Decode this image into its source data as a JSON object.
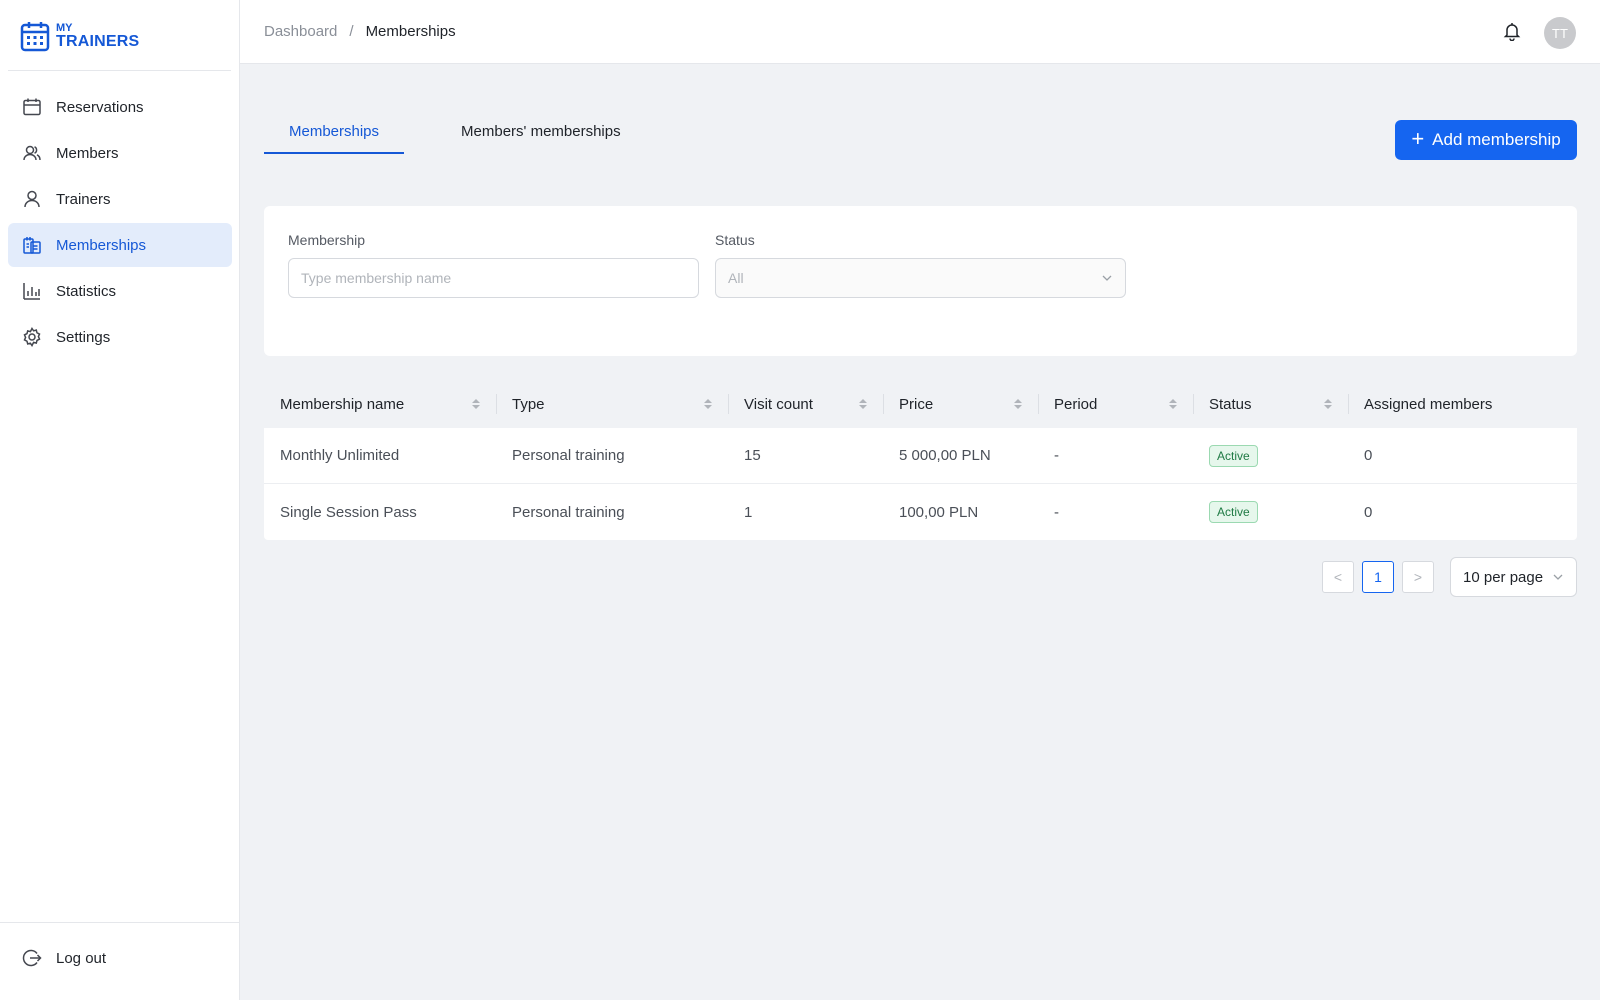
{
  "app": {
    "logo_line1": "MY",
    "logo_line2": "TRAINERS",
    "brand_color": "#1558d6"
  },
  "sidebar": {
    "items": [
      {
        "label": "Reservations",
        "icon": "calendar-icon",
        "active": false
      },
      {
        "label": "Members",
        "icon": "users-icon",
        "active": false
      },
      {
        "label": "Trainers",
        "icon": "user-icon",
        "active": false
      },
      {
        "label": "Memberships",
        "icon": "membership-card-icon",
        "active": true
      },
      {
        "label": "Statistics",
        "icon": "bar-chart-icon",
        "active": false
      },
      {
        "label": "Settings",
        "icon": "gear-icon",
        "active": false
      }
    ],
    "logout_label": "Log out"
  },
  "header": {
    "breadcrumb": [
      "Dashboard",
      "Memberships"
    ],
    "breadcrumb_separator": "/",
    "avatar_initials": "TT"
  },
  "tabs": [
    {
      "label": "Memberships",
      "active": true
    },
    {
      "label": "Members' memberships",
      "active": false
    }
  ],
  "add_button_label": "Add membership",
  "filters": {
    "membership_label": "Membership",
    "membership_placeholder": "Type membership name",
    "membership_value": "",
    "status_label": "Status",
    "status_value": "All"
  },
  "table": {
    "columns": [
      "Membership name",
      "Type",
      "Visit count",
      "Price",
      "Period",
      "Status",
      "Assigned members"
    ],
    "rows": [
      {
        "name": "Monthly Unlimited",
        "type": "Personal training",
        "visit_count": "15",
        "price": "5 000,00 PLN",
        "period": "-",
        "status": "Active",
        "assigned": "0"
      },
      {
        "name": "Single Session Pass",
        "type": "Personal training",
        "visit_count": "1",
        "price": "100,00 PLN",
        "period": "-",
        "status": "Active",
        "assigned": "0"
      }
    ]
  },
  "pagination": {
    "prev": "<",
    "current_page": "1",
    "next": ">",
    "per_page": "10 per page"
  }
}
